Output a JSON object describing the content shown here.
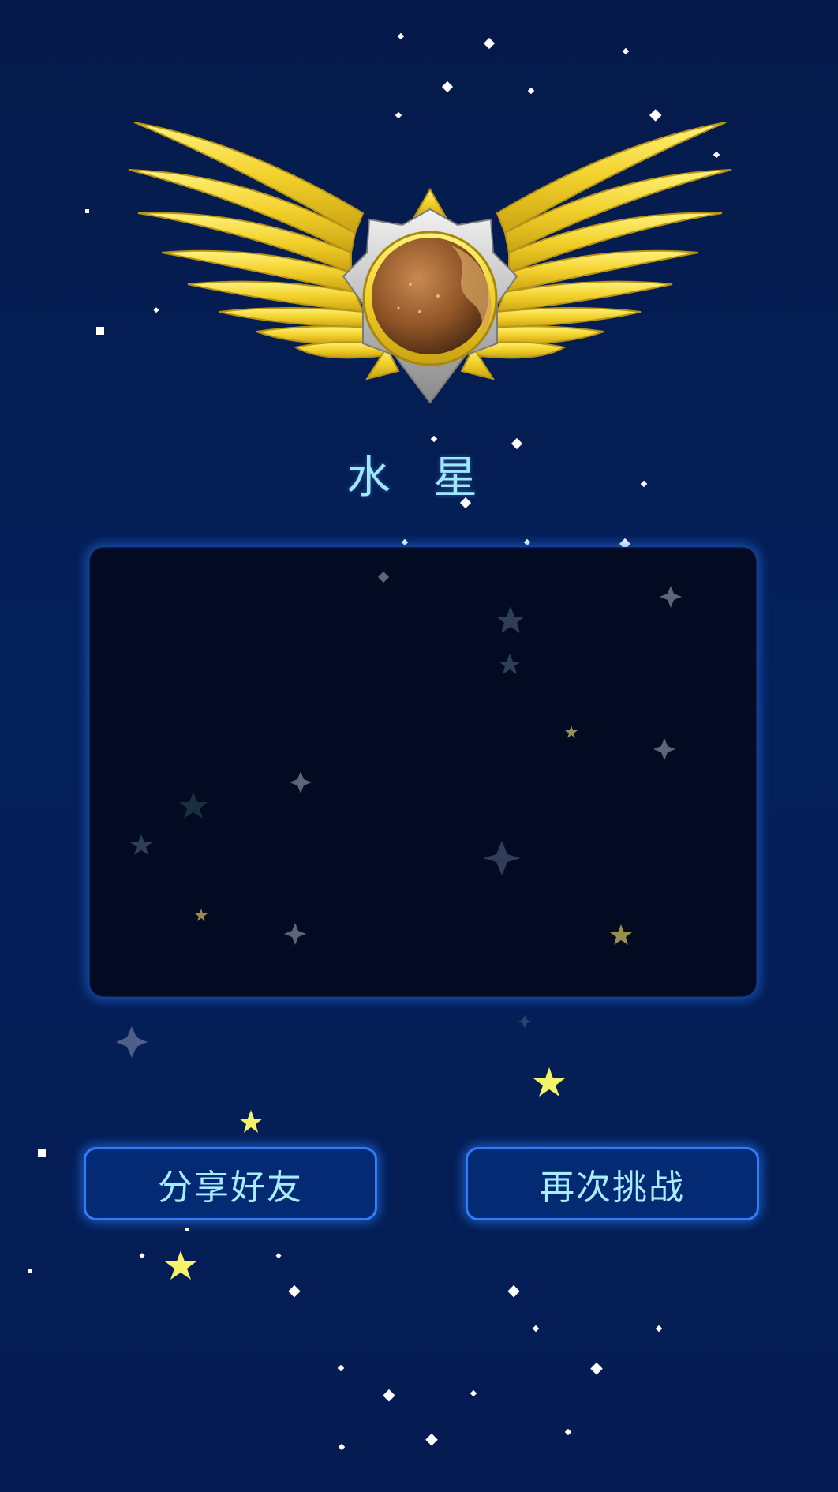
{
  "result": {
    "planet_name": "水 星",
    "badge_icon": "winged-medal-mercury-icon"
  },
  "actions": {
    "share_label": "分享好友",
    "retry_label": "再次挑战"
  },
  "colors": {
    "background": "#04205a",
    "panel": "#020b22",
    "accent": "#2f7cff",
    "title_text": "#9fe6ff",
    "button_text": "#a7ecff",
    "gold": "#f2d02a"
  }
}
